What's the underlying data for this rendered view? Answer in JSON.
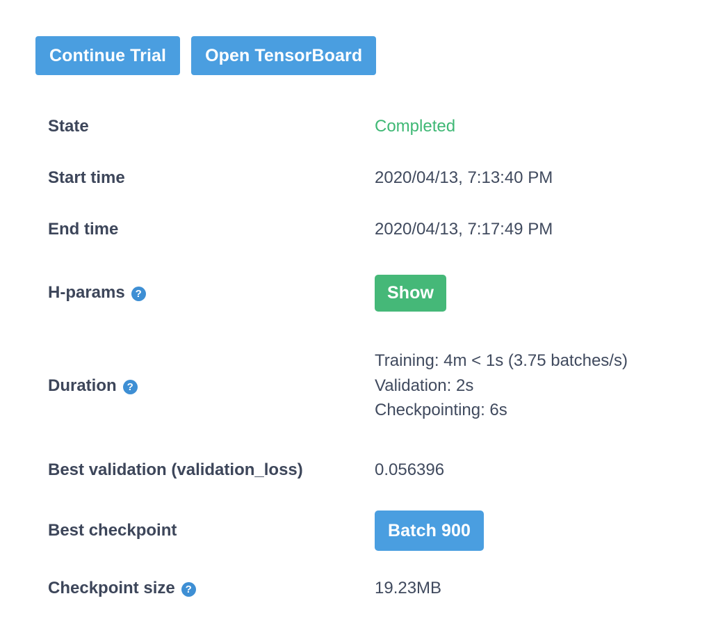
{
  "toolbar": {
    "continue_trial_label": "Continue Trial",
    "open_tensorboard_label": "Open TensorBoard"
  },
  "colors": {
    "primary_blue": "#4a9ee0",
    "success_green": "#45b878",
    "state_green": "#3fb875",
    "label_text": "#3d465a",
    "value_text": "#404a5e",
    "help_icon_blue": "#3e8fd4",
    "background": "#ffffff"
  },
  "details": {
    "state": {
      "label": "State",
      "value": "Completed"
    },
    "start_time": {
      "label": "Start time",
      "value": "2020/04/13, 7:13:40 PM"
    },
    "end_time": {
      "label": "End time",
      "value": "2020/04/13, 7:17:49 PM"
    },
    "hparams": {
      "label": "H-params",
      "help_glyph": "?",
      "show_button_label": "Show"
    },
    "duration": {
      "label": "Duration",
      "help_glyph": "?",
      "training": "Training: 4m < 1s (3.75 batches/s)",
      "validation": "Validation: 2s",
      "checkpointing": "Checkpointing: 6s"
    },
    "best_validation": {
      "label": "Best validation (validation_loss)",
      "value": "0.056396"
    },
    "best_checkpoint": {
      "label": "Best checkpoint",
      "button_label": "Batch 900"
    },
    "checkpoint_size": {
      "label": "Checkpoint size",
      "help_glyph": "?",
      "value": "19.23MB"
    }
  }
}
